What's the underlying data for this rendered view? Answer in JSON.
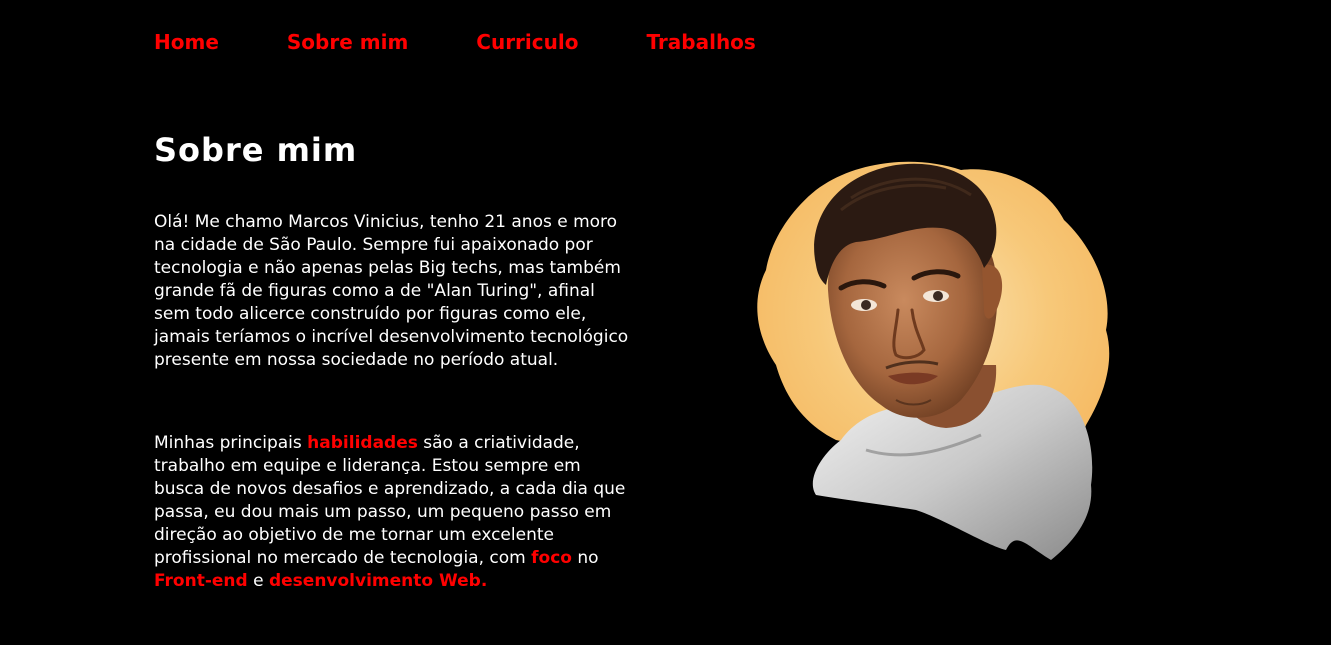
{
  "nav": {
    "items": [
      {
        "label": "Home"
      },
      {
        "label": "Sobre mim"
      },
      {
        "label": "Curriculo"
      },
      {
        "label": "Trabalhos"
      }
    ]
  },
  "about": {
    "title": "Sobre mim",
    "paragraph1": "Olá! Me chamo Marcos Vinicius, tenho 21 anos e moro na cidade de São Paulo. Sempre fui apaixonado por tecnologia e não apenas pelas Big techs, mas também grande fã de figuras como a de \"Alan Turing\", afinal sem todo alicerce construído por figuras como ele, jamais teríamos o incrível desenvolvimento tecnológico presente em nossa sociedade no período atual.",
    "paragraph2": {
      "part1": "Minhas principais ",
      "highlight1": "habilidades",
      "part2": " são a criatividade, trabalho em equipe e liderança. Estou sempre em busca de novos desafios e aprendizado, a cada dia que passa, eu dou mais um passo, um pequeno passo em direção ao objetivo de me tornar um excelente profissional no mercado de tecnologia, com ",
      "highlight2": "foco",
      "part3": " no ",
      "highlight3": "Front-end",
      "part4": " e ",
      "highlight4": "desenvolvimento Web."
    }
  },
  "photo": {
    "icon": "portrait-illustration"
  },
  "colors": {
    "background": "#000000",
    "accent": "#ff0000",
    "text": "#ffffff",
    "photo_backdrop": "#f7c879"
  }
}
